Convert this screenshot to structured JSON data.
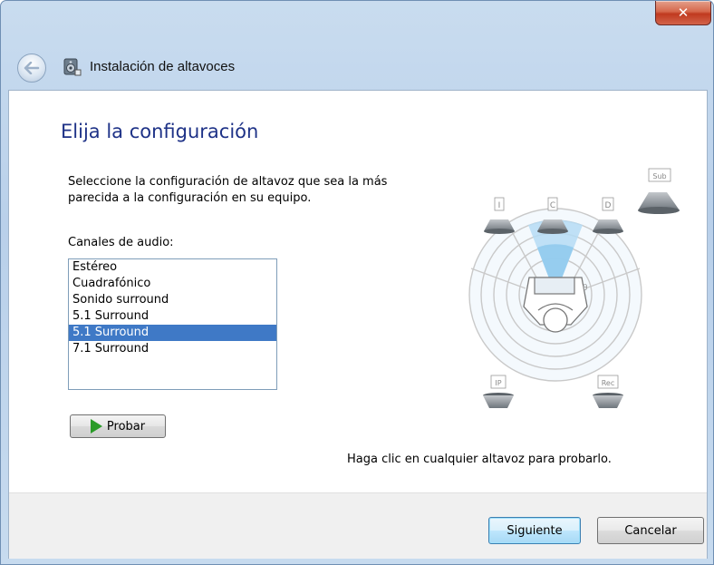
{
  "window": {
    "title": "Instalación de altavoces",
    "close_glyph": "✕"
  },
  "header": {
    "back_icon": "back-arrow-icon",
    "app_icon": "speaker-setup-icon"
  },
  "main": {
    "heading": "Elija la configuración",
    "description": "Seleccione la configuración de altavoz que sea la más parecida a la configuración en su equipo.",
    "channels_label": "Canales de audio:",
    "channels": [
      {
        "label": "Estéreo",
        "selected": false
      },
      {
        "label": "Cuadrafónico",
        "selected": false
      },
      {
        "label": "Sonido surround",
        "selected": false
      },
      {
        "label": "5.1 Surround",
        "selected": false
      },
      {
        "label": "5.1 Surround",
        "selected": true
      },
      {
        "label": "7.1 Surround",
        "selected": false
      }
    ],
    "test_button": "Probar",
    "hint": "Haga clic en cualquier altavoz para probarlo."
  },
  "diagram": {
    "speakers": {
      "front_left": "I",
      "center": "C",
      "front_right": "D",
      "subwoofer": "Sub",
      "rear_left": "IP",
      "rear_right": "Rec"
    }
  },
  "footer": {
    "next_button": "Siguiente",
    "cancel_button": "Cancelar"
  },
  "colors": {
    "heading": "#1e3287",
    "selection": "#3f79c6",
    "titlebar": "#c9dcef"
  }
}
